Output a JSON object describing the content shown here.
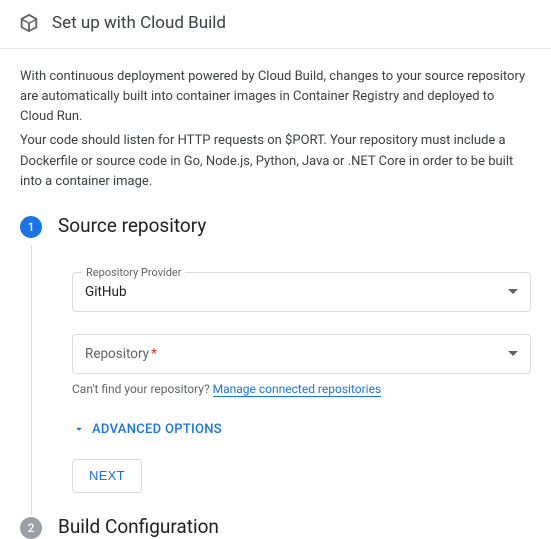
{
  "header": {
    "title": "Set up with Cloud Build"
  },
  "intro": {
    "p1": "With continuous deployment powered by Cloud Build, changes to your source repository are automatically built into container images in Container Registry and deployed to Cloud Run.",
    "p2": "Your code should listen for HTTP requests on $PORT. Your repository must include a Dockerfile or source code in Go, Node.js, Python, Java or .NET Core in order to be built into a container image."
  },
  "steps": {
    "s1": {
      "num": "1",
      "title": "Source repository",
      "provider_label": "Repository Provider",
      "provider_value": "GitHub",
      "repo_label": "Repository",
      "helper_prefix": "Can't find your repository? ",
      "helper_link": "Manage connected repositories",
      "advanced": "ADVANCED OPTIONS",
      "next": "NEXT"
    },
    "s2": {
      "num": "2",
      "title": "Build Configuration"
    }
  }
}
